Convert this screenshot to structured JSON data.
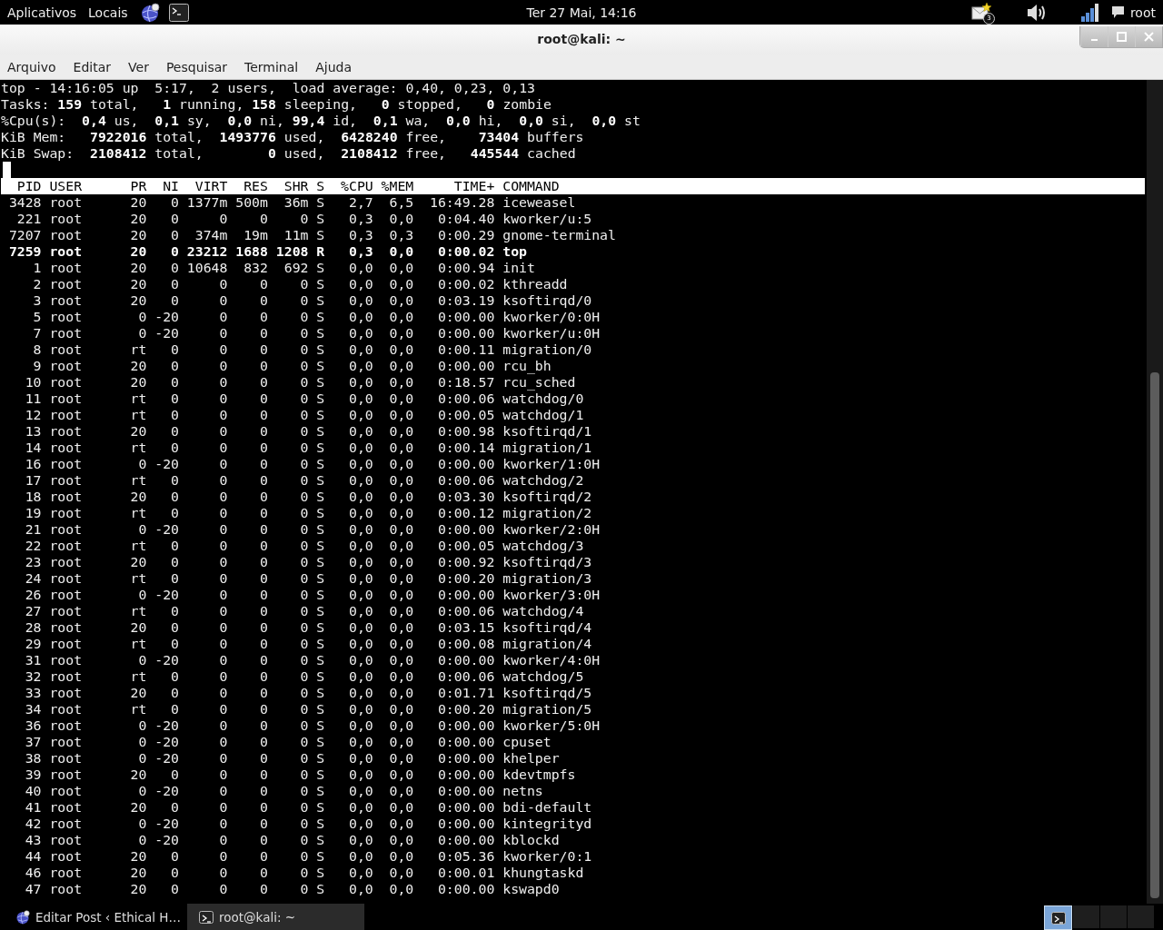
{
  "top_panel": {
    "menus": [
      "Aplicativos",
      "Locais"
    ],
    "clock": "Ter 27 Mai, 14:16",
    "mail_badge": "3",
    "user": "root"
  },
  "window": {
    "title": "root@kali: ~"
  },
  "menubar": [
    "Arquivo",
    "Editar",
    "Ver",
    "Pesquisar",
    "Terminal",
    "Ajuda"
  ],
  "summary": [
    "top - 14:16:05 up  5:17,  2 users,  load average: 0,40, 0,23, 0,13",
    "Tasks: **159** total,   **1** running, **158** sleeping,   **0** stopped,   **0** zombie",
    "%Cpu(s):  **0,4** us,  **0,1** sy,  **0,0** ni, **99,4** id,  **0,1** wa,  **0,0** hi,  **0,0** si,  **0,0** st",
    "KiB Mem:   **7922016** total,  **1493776** used,  **6428240** free,    **73404** buffers",
    "KiB Swap:  **2108412** total,        **0** used,  **2108412** free,   **445544** cached"
  ],
  "table": {
    "columns": [
      "PID",
      "USER",
      "PR",
      "NI",
      "VIRT",
      "RES",
      "SHR",
      "S",
      "%CPU",
      "%MEM",
      "TIME+",
      "COMMAND"
    ],
    "rows": [
      {
        "cells": [
          "3428",
          "root",
          "20",
          "0",
          "1377m",
          "500m",
          "36m",
          "S",
          "2,7",
          "6,5",
          "16:49.28",
          "iceweasel"
        ],
        "highlighted": false
      },
      {
        "cells": [
          "221",
          "root",
          "20",
          "0",
          "0",
          "0",
          "0",
          "S",
          "0,3",
          "0,0",
          "0:04.40",
          "kworker/u:5"
        ],
        "highlighted": false
      },
      {
        "cells": [
          "7207",
          "root",
          "20",
          "0",
          "374m",
          "19m",
          "11m",
          "S",
          "0,3",
          "0,3",
          "0:00.29",
          "gnome-terminal"
        ],
        "highlighted": false
      },
      {
        "cells": [
          "7259",
          "root",
          "20",
          "0",
          "23212",
          "1688",
          "1208",
          "R",
          "0,3",
          "0,0",
          "0:00.02",
          "top"
        ],
        "highlighted": true
      },
      {
        "cells": [
          "1",
          "root",
          "20",
          "0",
          "10648",
          "832",
          "692",
          "S",
          "0,0",
          "0,0",
          "0:00.94",
          "init"
        ],
        "highlighted": false
      },
      {
        "cells": [
          "2",
          "root",
          "20",
          "0",
          "0",
          "0",
          "0",
          "S",
          "0,0",
          "0,0",
          "0:00.02",
          "kthreadd"
        ],
        "highlighted": false
      },
      {
        "cells": [
          "3",
          "root",
          "20",
          "0",
          "0",
          "0",
          "0",
          "S",
          "0,0",
          "0,0",
          "0:03.19",
          "ksoftirqd/0"
        ],
        "highlighted": false
      },
      {
        "cells": [
          "5",
          "root",
          "0",
          "-20",
          "0",
          "0",
          "0",
          "S",
          "0,0",
          "0,0",
          "0:00.00",
          "kworker/0:0H"
        ],
        "highlighted": false
      },
      {
        "cells": [
          "7",
          "root",
          "0",
          "-20",
          "0",
          "0",
          "0",
          "S",
          "0,0",
          "0,0",
          "0:00.00",
          "kworker/u:0H"
        ],
        "highlighted": false
      },
      {
        "cells": [
          "8",
          "root",
          "rt",
          "0",
          "0",
          "0",
          "0",
          "S",
          "0,0",
          "0,0",
          "0:00.11",
          "migration/0"
        ],
        "highlighted": false
      },
      {
        "cells": [
          "9",
          "root",
          "20",
          "0",
          "0",
          "0",
          "0",
          "S",
          "0,0",
          "0,0",
          "0:00.00",
          "rcu_bh"
        ],
        "highlighted": false
      },
      {
        "cells": [
          "10",
          "root",
          "20",
          "0",
          "0",
          "0",
          "0",
          "S",
          "0,0",
          "0,0",
          "0:18.57",
          "rcu_sched"
        ],
        "highlighted": false
      },
      {
        "cells": [
          "11",
          "root",
          "rt",
          "0",
          "0",
          "0",
          "0",
          "S",
          "0,0",
          "0,0",
          "0:00.06",
          "watchdog/0"
        ],
        "highlighted": false
      },
      {
        "cells": [
          "12",
          "root",
          "rt",
          "0",
          "0",
          "0",
          "0",
          "S",
          "0,0",
          "0,0",
          "0:00.05",
          "watchdog/1"
        ],
        "highlighted": false
      },
      {
        "cells": [
          "13",
          "root",
          "20",
          "0",
          "0",
          "0",
          "0",
          "S",
          "0,0",
          "0,0",
          "0:00.98",
          "ksoftirqd/1"
        ],
        "highlighted": false
      },
      {
        "cells": [
          "14",
          "root",
          "rt",
          "0",
          "0",
          "0",
          "0",
          "S",
          "0,0",
          "0,0",
          "0:00.14",
          "migration/1"
        ],
        "highlighted": false
      },
      {
        "cells": [
          "16",
          "root",
          "0",
          "-20",
          "0",
          "0",
          "0",
          "S",
          "0,0",
          "0,0",
          "0:00.00",
          "kworker/1:0H"
        ],
        "highlighted": false
      },
      {
        "cells": [
          "17",
          "root",
          "rt",
          "0",
          "0",
          "0",
          "0",
          "S",
          "0,0",
          "0,0",
          "0:00.06",
          "watchdog/2"
        ],
        "highlighted": false
      },
      {
        "cells": [
          "18",
          "root",
          "20",
          "0",
          "0",
          "0",
          "0",
          "S",
          "0,0",
          "0,0",
          "0:03.30",
          "ksoftirqd/2"
        ],
        "highlighted": false
      },
      {
        "cells": [
          "19",
          "root",
          "rt",
          "0",
          "0",
          "0",
          "0",
          "S",
          "0,0",
          "0,0",
          "0:00.12",
          "migration/2"
        ],
        "highlighted": false
      },
      {
        "cells": [
          "21",
          "root",
          "0",
          "-20",
          "0",
          "0",
          "0",
          "S",
          "0,0",
          "0,0",
          "0:00.00",
          "kworker/2:0H"
        ],
        "highlighted": false
      },
      {
        "cells": [
          "22",
          "root",
          "rt",
          "0",
          "0",
          "0",
          "0",
          "S",
          "0,0",
          "0,0",
          "0:00.05",
          "watchdog/3"
        ],
        "highlighted": false
      },
      {
        "cells": [
          "23",
          "root",
          "20",
          "0",
          "0",
          "0",
          "0",
          "S",
          "0,0",
          "0,0",
          "0:00.92",
          "ksoftirqd/3"
        ],
        "highlighted": false
      },
      {
        "cells": [
          "24",
          "root",
          "rt",
          "0",
          "0",
          "0",
          "0",
          "S",
          "0,0",
          "0,0",
          "0:00.20",
          "migration/3"
        ],
        "highlighted": false
      },
      {
        "cells": [
          "26",
          "root",
          "0",
          "-20",
          "0",
          "0",
          "0",
          "S",
          "0,0",
          "0,0",
          "0:00.00",
          "kworker/3:0H"
        ],
        "highlighted": false
      },
      {
        "cells": [
          "27",
          "root",
          "rt",
          "0",
          "0",
          "0",
          "0",
          "S",
          "0,0",
          "0,0",
          "0:00.06",
          "watchdog/4"
        ],
        "highlighted": false
      },
      {
        "cells": [
          "28",
          "root",
          "20",
          "0",
          "0",
          "0",
          "0",
          "S",
          "0,0",
          "0,0",
          "0:03.15",
          "ksoftirqd/4"
        ],
        "highlighted": false
      },
      {
        "cells": [
          "29",
          "root",
          "rt",
          "0",
          "0",
          "0",
          "0",
          "S",
          "0,0",
          "0,0",
          "0:00.08",
          "migration/4"
        ],
        "highlighted": false
      },
      {
        "cells": [
          "31",
          "root",
          "0",
          "-20",
          "0",
          "0",
          "0",
          "S",
          "0,0",
          "0,0",
          "0:00.00",
          "kworker/4:0H"
        ],
        "highlighted": false
      },
      {
        "cells": [
          "32",
          "root",
          "rt",
          "0",
          "0",
          "0",
          "0",
          "S",
          "0,0",
          "0,0",
          "0:00.06",
          "watchdog/5"
        ],
        "highlighted": false
      },
      {
        "cells": [
          "33",
          "root",
          "20",
          "0",
          "0",
          "0",
          "0",
          "S",
          "0,0",
          "0,0",
          "0:01.71",
          "ksoftirqd/5"
        ],
        "highlighted": false
      },
      {
        "cells": [
          "34",
          "root",
          "rt",
          "0",
          "0",
          "0",
          "0",
          "S",
          "0,0",
          "0,0",
          "0:00.20",
          "migration/5"
        ],
        "highlighted": false
      },
      {
        "cells": [
          "36",
          "root",
          "0",
          "-20",
          "0",
          "0",
          "0",
          "S",
          "0,0",
          "0,0",
          "0:00.00",
          "kworker/5:0H"
        ],
        "highlighted": false
      },
      {
        "cells": [
          "37",
          "root",
          "0",
          "-20",
          "0",
          "0",
          "0",
          "S",
          "0,0",
          "0,0",
          "0:00.00",
          "cpuset"
        ],
        "highlighted": false
      },
      {
        "cells": [
          "38",
          "root",
          "0",
          "-20",
          "0",
          "0",
          "0",
          "S",
          "0,0",
          "0,0",
          "0:00.00",
          "khelper"
        ],
        "highlighted": false
      },
      {
        "cells": [
          "39",
          "root",
          "20",
          "0",
          "0",
          "0",
          "0",
          "S",
          "0,0",
          "0,0",
          "0:00.00",
          "kdevtmpfs"
        ],
        "highlighted": false
      },
      {
        "cells": [
          "40",
          "root",
          "0",
          "-20",
          "0",
          "0",
          "0",
          "S",
          "0,0",
          "0,0",
          "0:00.00",
          "netns"
        ],
        "highlighted": false
      },
      {
        "cells": [
          "41",
          "root",
          "20",
          "0",
          "0",
          "0",
          "0",
          "S",
          "0,0",
          "0,0",
          "0:00.00",
          "bdi-default"
        ],
        "highlighted": false
      },
      {
        "cells": [
          "42",
          "root",
          "0",
          "-20",
          "0",
          "0",
          "0",
          "S",
          "0,0",
          "0,0",
          "0:00.00",
          "kintegrityd"
        ],
        "highlighted": false
      },
      {
        "cells": [
          "43",
          "root",
          "0",
          "-20",
          "0",
          "0",
          "0",
          "S",
          "0,0",
          "0,0",
          "0:00.00",
          "kblockd"
        ],
        "highlighted": false
      },
      {
        "cells": [
          "44",
          "root",
          "20",
          "0",
          "0",
          "0",
          "0",
          "S",
          "0,0",
          "0,0",
          "0:05.36",
          "kworker/0:1"
        ],
        "highlighted": false
      },
      {
        "cells": [
          "46",
          "root",
          "20",
          "0",
          "0",
          "0",
          "0",
          "S",
          "0,0",
          "0,0",
          "0:00.01",
          "khungtaskd"
        ],
        "highlighted": false
      },
      {
        "cells": [
          "47",
          "root",
          "20",
          "0",
          "0",
          "0",
          "0",
          "S",
          "0,0",
          "0,0",
          "0:00.00",
          "kswapd0"
        ],
        "highlighted": false
      }
    ]
  },
  "taskbar": {
    "tasks": [
      {
        "label": "Editar Post ‹ Ethical H…",
        "kind": "browser",
        "selected": false
      },
      {
        "label": "root@kali: ~",
        "kind": "terminal",
        "selected": true
      }
    ],
    "workspaces": [
      {
        "selected": true
      },
      {
        "selected": false
      },
      {
        "selected": false
      },
      {
        "selected": false
      }
    ]
  }
}
